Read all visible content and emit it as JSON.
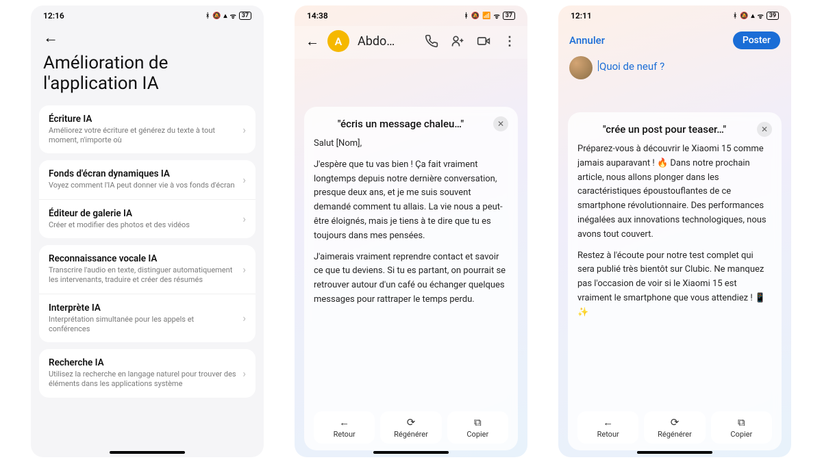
{
  "phone1": {
    "status": {
      "time": "12:16",
      "battery": "37"
    },
    "title": "Amélioration de l'application IA",
    "groups": [
      [
        {
          "title": "Écriture IA",
          "desc": "Améliorez votre écriture et générez du texte à tout moment, n'importe où"
        }
      ],
      [
        {
          "title": "Fonds d'écran dynamiques IA",
          "desc": "Voyez comment l'IA peut donner vie à vos fonds d'écran"
        },
        {
          "title": "Éditeur de galerie IA",
          "desc": "Créer et modifier des photos et des vidéos"
        }
      ],
      [
        {
          "title": "Reconnaissance vocale IA",
          "desc": "Transcrire l'audio en texte, distinguer automatiquement les intervenants, traduire et créer des résumés"
        },
        {
          "title": "Interprète IA",
          "desc": "Interprétation simultanée pour les appels et conférences"
        }
      ],
      [
        {
          "title": "Recherche IA",
          "desc": "Utilisez la recherche en langage naturel pour trouver des éléments dans les applications système"
        }
      ]
    ]
  },
  "phone2": {
    "status": {
      "time": "14:38",
      "battery": "37"
    },
    "contact_initial": "A",
    "contact_name": "Abdo…",
    "prompt": "\"écris un message chaleu…\"",
    "message_greeting": "Salut [Nom],",
    "message_p1": "J'espère que tu vas bien ! Ça fait vraiment longtemps depuis notre dernière conversation, presque deux ans, et je me suis souvent demandé comment tu allais. La vie nous a peut-être éloignés, mais je tiens à te dire que tu es toujours dans mes pensées.",
    "message_p2": "J'aimerais vraiment reprendre contact et savoir ce que tu deviens. Si tu es partant, on pourrait se retrouver autour d'un café ou échanger quelques messages pour rattraper le temps perdu.",
    "actions": {
      "back": "Retour",
      "regen": "Régénérer",
      "copy": "Copier"
    }
  },
  "phone3": {
    "status": {
      "time": "12:11",
      "battery": "39"
    },
    "cancel": "Annuler",
    "post": "Poster",
    "placeholder": "Quoi de neuf ?",
    "prompt": "\"crée un post pour teaser…\"",
    "body_p1": "Préparez-vous à découvrir le Xiaomi 15 comme jamais auparavant ! 🔥 Dans notre prochain article, nous allons plonger dans les caractéristiques époustouflantes de ce smartphone révolutionnaire. Des performances inégalées aux innovations technologiques, nous avons tout couvert.",
    "body_p2": "Restez à l'écoute pour notre test complet qui sera publié très bientôt sur Clubic. Ne manquez pas l'occasion de voir si le Xiaomi 15 est vraiment le smartphone que vous attendiez ! 📱✨",
    "actions": {
      "back": "Retour",
      "regen": "Régénérer",
      "copy": "Copier"
    }
  }
}
